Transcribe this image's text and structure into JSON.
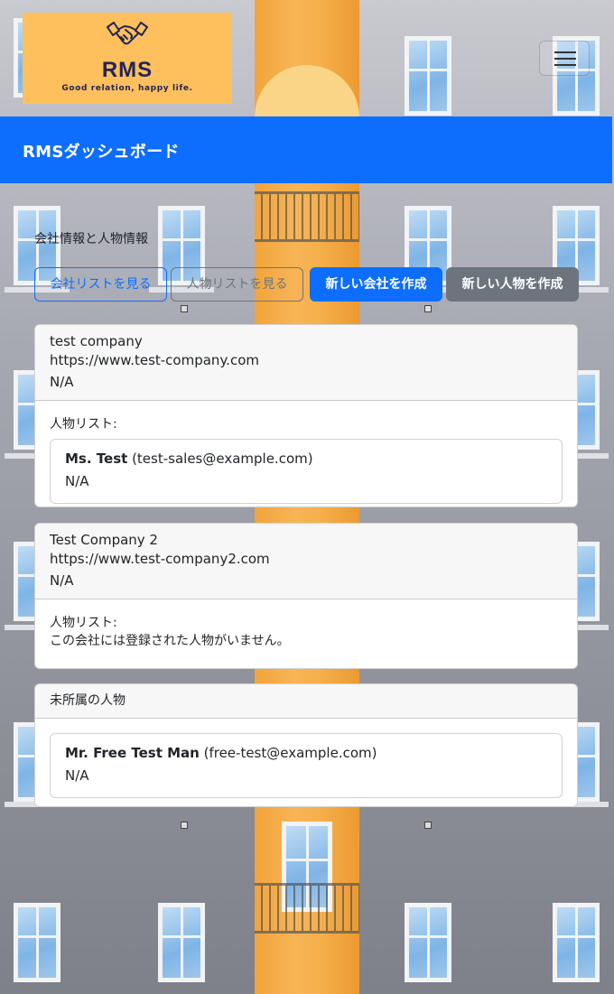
{
  "brand": {
    "name": "RMS",
    "tagline": "Good relation, happy life.",
    "logo_color": "#fdc05d",
    "logo_text_color": "#242459"
  },
  "header": {
    "menu_icon": "hamburger-menu-icon",
    "dashboard_title": "RMSダッシュボード",
    "bar_color": "#0d6efd"
  },
  "section": {
    "label": "会社情報と人物情報"
  },
  "actions": {
    "view_companies": "会社リストを見る",
    "view_people": "人物リストを見る",
    "new_company": "新しい会社を作成",
    "new_person": "新しい人物を作成"
  },
  "companies": [
    {
      "name": "test company",
      "url": "https://www.test-company.com",
      "note": "N/A",
      "people_label": "人物リスト:",
      "people": [
        {
          "name": "Ms. Test",
          "email": "(test-sales@example.com)",
          "note": "N/A"
        }
      ]
    },
    {
      "name": "Test Company 2",
      "url": "https://www.test-company2.com",
      "note": "N/A",
      "people_label": "人物リスト:",
      "empty_message": "この会社には登録された人物がいません。"
    }
  ],
  "unaffiliated": {
    "title": "未所属の人物",
    "people": [
      {
        "name": "Mr. Free Test Man",
        "email": "(free-test@example.com)",
        "note": "N/A"
      }
    ]
  }
}
